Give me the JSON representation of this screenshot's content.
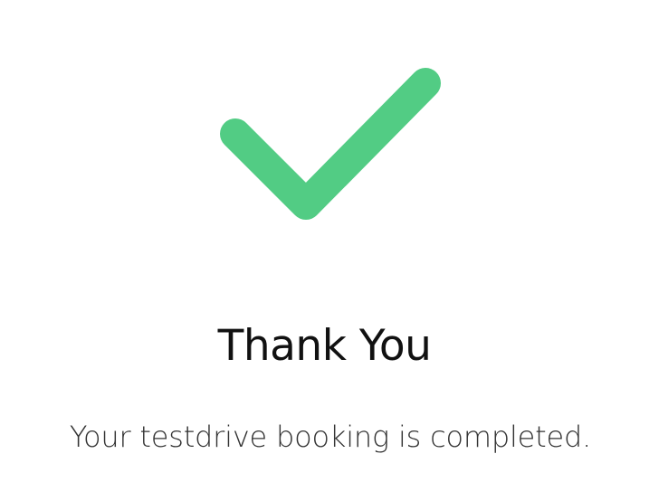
{
  "confirmation": {
    "icon": "check-icon",
    "icon_color": "#52CC84",
    "title": "Thank You",
    "message": "Your testdrive booking is completed."
  }
}
